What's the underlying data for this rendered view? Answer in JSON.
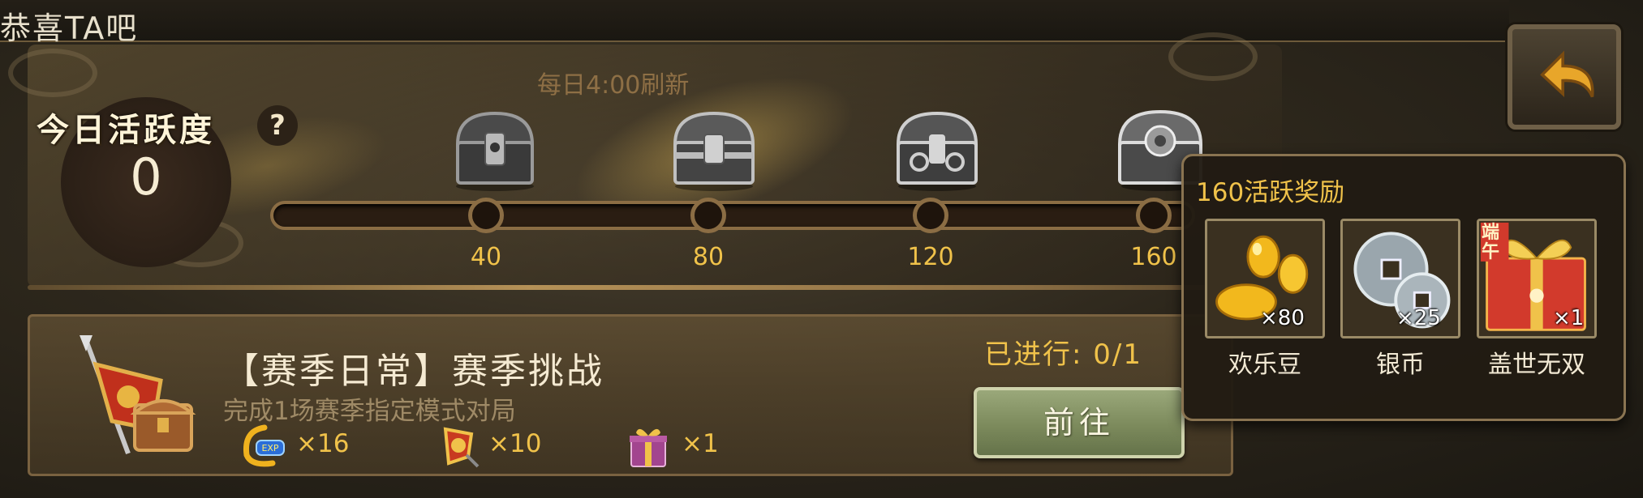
{
  "ticker": {
    "text": "恭喜TA吧"
  },
  "activity": {
    "title": "今日活跃度",
    "help_label": "?",
    "score": "0",
    "refresh_text": "每日4:00刷新",
    "milestones": [
      {
        "value": "40",
        "icon": "treasure-chest-icon"
      },
      {
        "value": "80",
        "icon": "treasure-chest-icon"
      },
      {
        "value": "120",
        "icon": "treasure-chest-icon"
      },
      {
        "value": "160",
        "icon": "treasure-chest-icon"
      }
    ]
  },
  "task": {
    "icon": "banner-chest-icon",
    "title": "【赛季日常】赛季挑战",
    "description": "完成1场赛季指定模式对局",
    "progress": "已进行: 0/1",
    "go_label": "前往",
    "rewards": [
      {
        "icon": "experience-icon",
        "count": "×16"
      },
      {
        "icon": "badge-icon",
        "count": "×10"
      },
      {
        "icon": "gift-box-icon",
        "count": "×1"
      }
    ]
  },
  "popup": {
    "title": "160活跃奖励",
    "rewards": [
      {
        "icon": "gold-beans-icon",
        "qty": "×80",
        "name": "欢乐豆"
      },
      {
        "icon": "silver-coin-icon",
        "qty": "×25",
        "name": "银币"
      },
      {
        "icon": "festival-gift-icon",
        "qty": "×1",
        "name": "盖世无双",
        "badge": "端午"
      }
    ]
  },
  "colors": {
    "gold": "#f0c24a",
    "panel": "#4a4130",
    "button_green": "#8a9866"
  }
}
